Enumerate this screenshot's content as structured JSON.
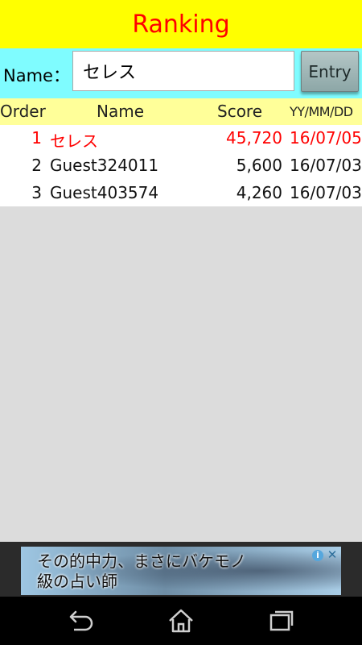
{
  "header": {
    "title": "Ranking"
  },
  "entry": {
    "name_label": "Name：",
    "name_value": "セレス",
    "entry_button": "Entry"
  },
  "table": {
    "columns": {
      "order": "Order",
      "name": "Name",
      "score": "Score",
      "date": "YY/MM/DD"
    },
    "rows": [
      {
        "order": "1",
        "name": "セレス",
        "score": "45,720",
        "date": "16/07/05",
        "highlight": true
      },
      {
        "order": "2",
        "name": "Guest324011",
        "score": "5,600",
        "date": "16/07/03",
        "highlight": false
      },
      {
        "order": "3",
        "name": "Guest403574",
        "score": "4,260",
        "date": "16/07/03",
        "highlight": false
      }
    ]
  },
  "ad": {
    "line1": "その的中力、まさにバケモノ",
    "line2": "級の占い師",
    "info_icon": "info-icon",
    "close_icon": "close-icon"
  },
  "nav": {
    "back": "back-icon",
    "home": "home-icon",
    "recents": "recents-icon"
  },
  "colors": {
    "title_bar": "#ffff00",
    "title_text": "#ff0000",
    "entry_bar": "#7ffcff",
    "header_row": "#ffff99",
    "highlight_text": "#ff0000",
    "empty_area": "#dcdcdc"
  }
}
